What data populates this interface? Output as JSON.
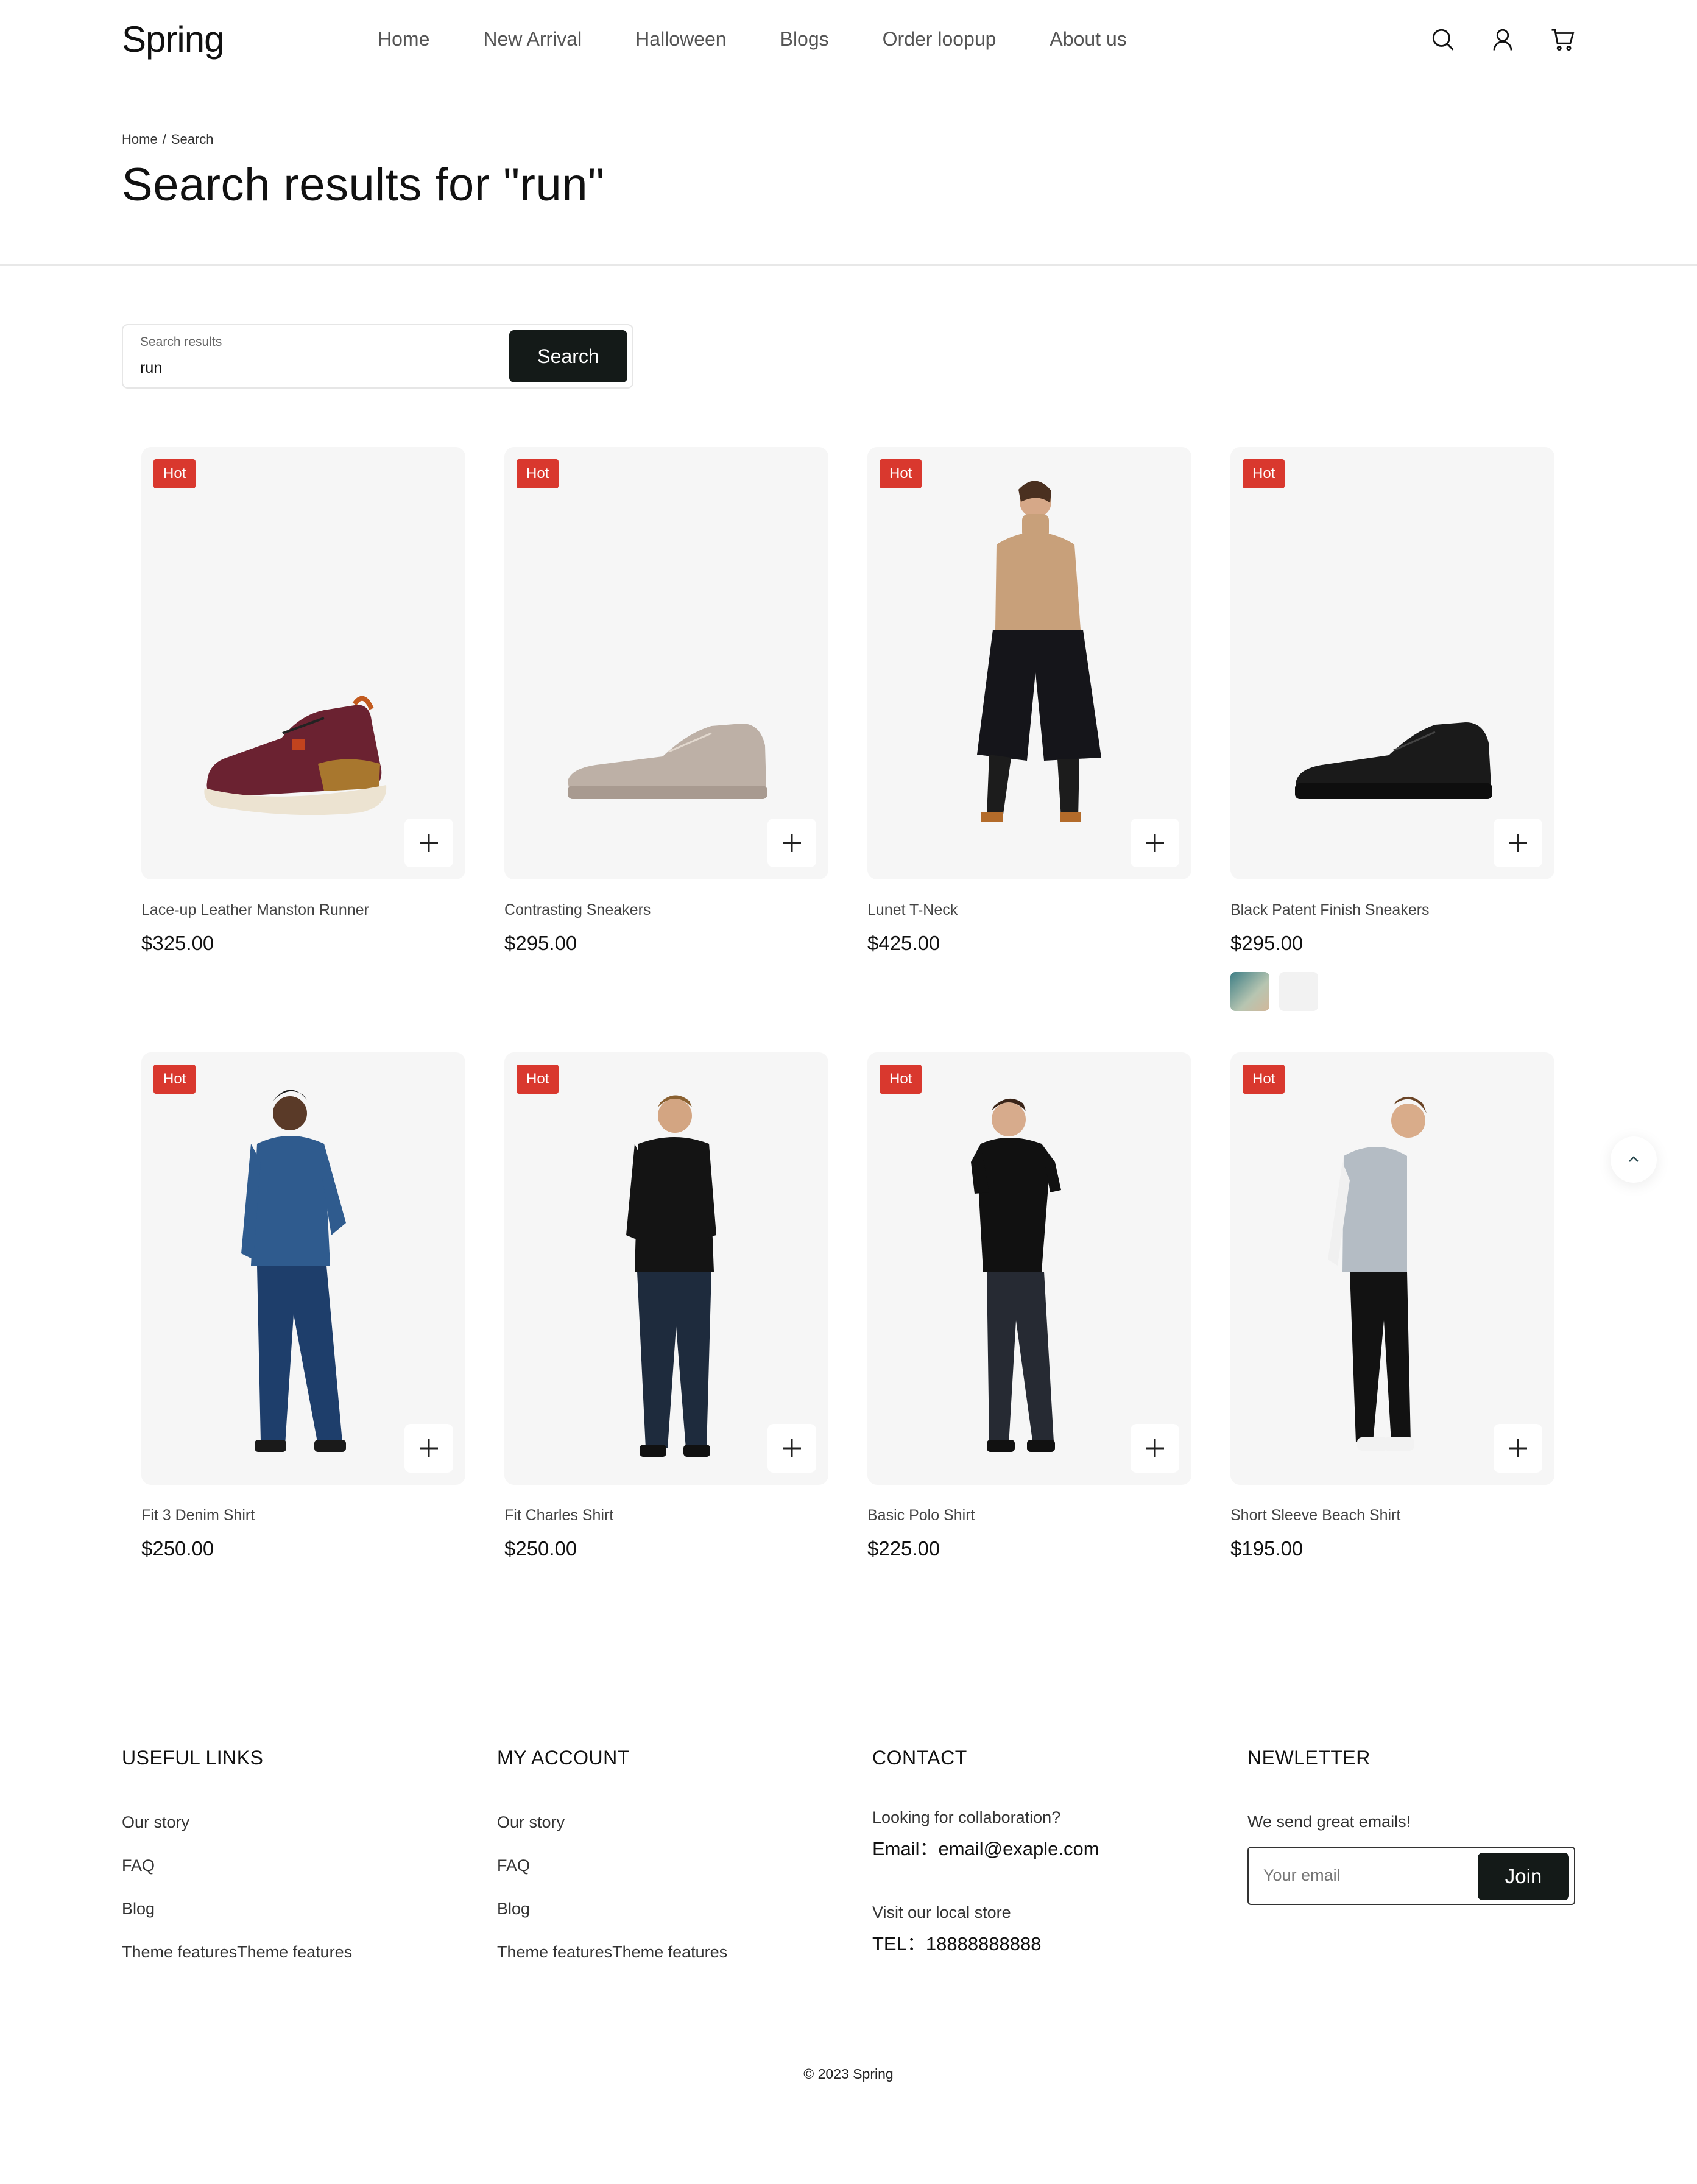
{
  "header": {
    "logo": "Spring",
    "nav": [
      "Home",
      "New Arrival",
      "Halloween",
      "Blogs",
      "Order loopup",
      "About us"
    ]
  },
  "breadcrumb": {
    "home": "Home",
    "separator": "/",
    "current": "Search"
  },
  "page_title": "Search results for \"run\"",
  "search": {
    "label": "Search results",
    "value": "run",
    "button": "Search"
  },
  "badge_label": "Hot",
  "products": [
    {
      "name": "Lace-up Leather Manston Runner",
      "price": "$325.00"
    },
    {
      "name": "Contrasting Sneakers",
      "price": "$295.00"
    },
    {
      "name": "Lunet T-Neck",
      "price": "$425.00"
    },
    {
      "name": "Black Patent Finish Sneakers",
      "price": "$295.00"
    },
    {
      "name": "Fit 3 Denim Shirt",
      "price": "$250.00"
    },
    {
      "name": "Fit Charles Shirt",
      "price": "$250.00"
    },
    {
      "name": "Basic Polo Shirt",
      "price": "$225.00"
    },
    {
      "name": "Short Sleeve Beach Shirt",
      "price": "$195.00"
    }
  ],
  "colors": {
    "badge": "#d9382e",
    "button": "#141a18",
    "card_bg": "#f6f6f6"
  },
  "footer": {
    "useful_links": {
      "title": "USEFUL LINKS",
      "links": [
        "Our story",
        "FAQ",
        "Blog",
        "Theme featuresTheme features"
      ]
    },
    "my_account": {
      "title": "MY ACCOUNT",
      "links": [
        "Our story",
        "FAQ",
        "Blog",
        "Theme featuresTheme features"
      ]
    },
    "contact": {
      "title": "CONTACT",
      "collab": "Looking for collaboration?",
      "email": "Email：email@exaple.com",
      "visit": "Visit our local store",
      "tel": "TEL：18888888888"
    },
    "newsletter": {
      "title": "NEWLETTER",
      "text": "We send great emails!",
      "placeholder": "Your email",
      "button": "Join"
    },
    "copyright": "© 2023 Spring"
  }
}
